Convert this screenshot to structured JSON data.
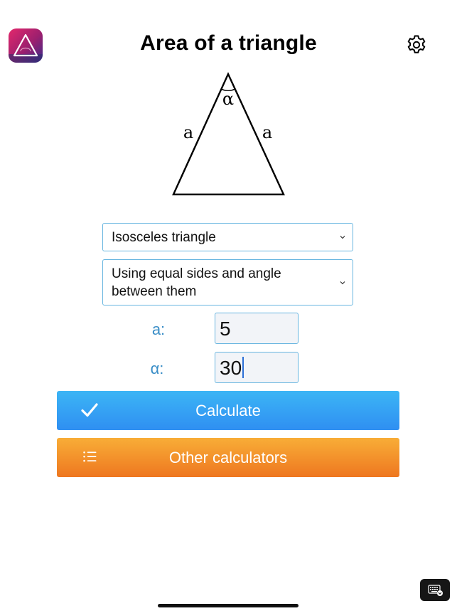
{
  "header": {
    "title": "Area of a triangle",
    "app_icon": "app-logo-icon",
    "settings_icon": "gear-icon"
  },
  "figure": {
    "side_left_label": "a",
    "side_right_label": "a",
    "angle_label": "α"
  },
  "selects": {
    "triangle_type": "Isosceles triangle",
    "method": "Using equal sides and angle between them"
  },
  "fields": [
    {
      "label": "a:",
      "value": "5"
    },
    {
      "label": "α:",
      "value": "30"
    }
  ],
  "buttons": {
    "calculate_label": "Calculate",
    "calculate_icon": "checkmark-icon",
    "other_label": "Other calculators",
    "other_icon": "list-icon"
  },
  "system": {
    "keyboard_icon": "keyboard-icon"
  },
  "colors": {
    "accent_blue": "#2f8ff2",
    "accent_orange": "#ee7720",
    "label_blue": "#3a8ec7",
    "border_blue": "#69b6e0"
  }
}
